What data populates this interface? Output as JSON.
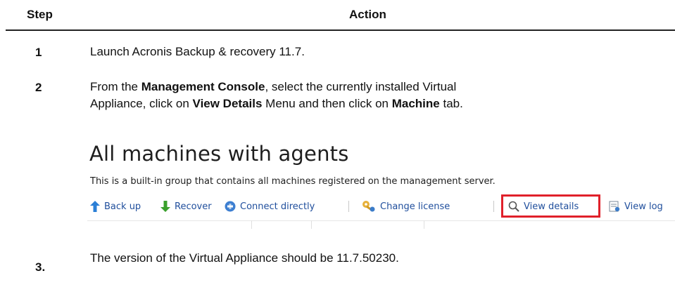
{
  "header": {
    "step_label": "Step",
    "action_label": "Action"
  },
  "steps": [
    {
      "number": "1",
      "text": "Launch Acronis Backup & recovery 11.7."
    },
    {
      "number": "2",
      "line1_a": "From the ",
      "line1_b": "Management Console",
      "line1_c": ", select the currently installed Virtual",
      "line2_a": "Appliance, click on ",
      "line2_b": "View Details",
      "line2_c": " Menu and then click on ",
      "line2_d": "Machine",
      "line2_e": " tab."
    },
    {
      "number": "3.",
      "text": "The version of the Virtual Appliance should be 11.7.50230."
    }
  ],
  "screenshot": {
    "title": "All machines with agents",
    "description": "This is a built-in group that contains all machines registered on the management server.",
    "toolbar": {
      "back_up": "Back up",
      "recover": "Recover",
      "connect_directly": "Connect directly",
      "change_license": "Change license",
      "view_details": "View details",
      "view_log": "View log"
    },
    "highlight_color": "#e0202a",
    "link_color": "#1f4e9c"
  }
}
